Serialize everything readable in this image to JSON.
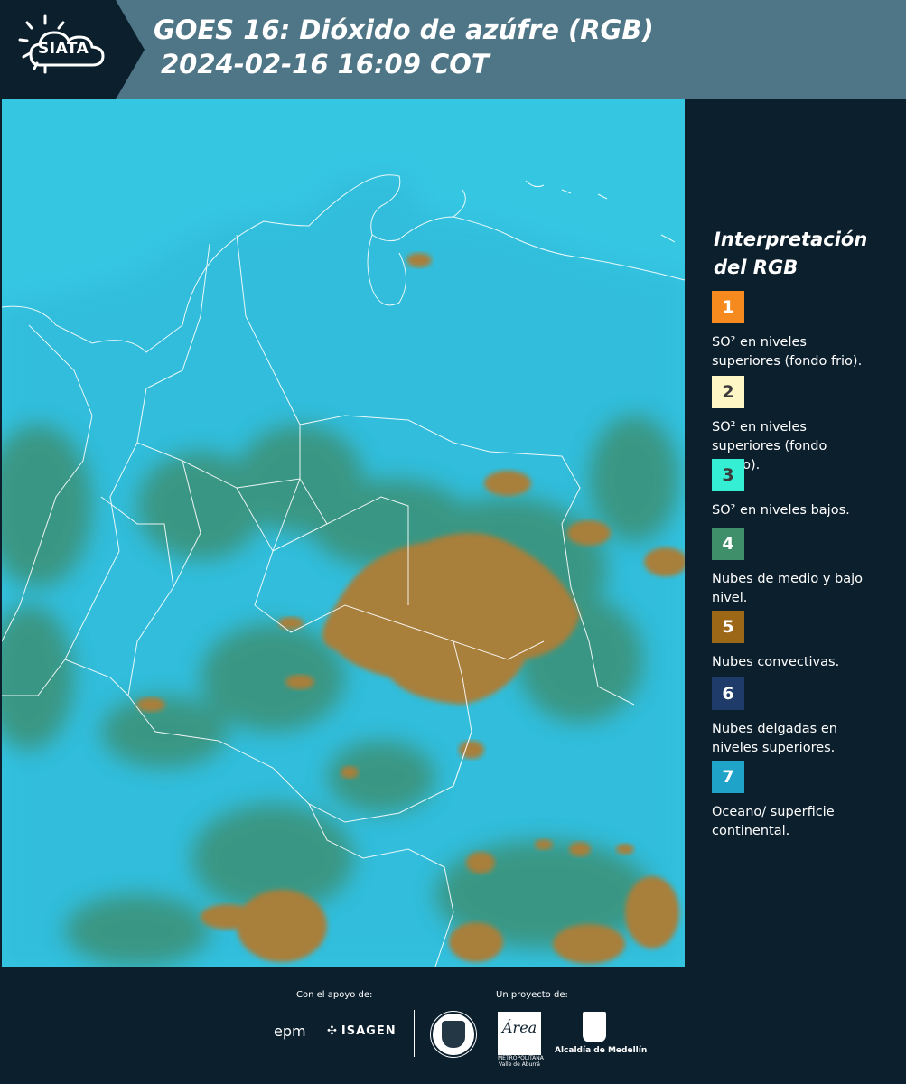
{
  "header": {
    "logo_text": "SIATA",
    "title_line1": "GOES 16: Dióxido de azúfre (RGB)",
    "title_line2": "2024-02-16 16:09 COT"
  },
  "legend": {
    "title": "Interpretación del RGB",
    "items": [
      {
        "number": "1",
        "color": "#f68a1f",
        "text_color": "#ffffff",
        "description": "SO² en niveles superiores (fondo frio)."
      },
      {
        "number": "2",
        "color": "#fff6c6",
        "text_color": "#3a3a3a",
        "description": "SO² en niveles superiores (fondo calido)."
      },
      {
        "number": "3",
        "color": "#34efd3",
        "text_color": "#3a3a3a",
        "description": "SO² en niveles bajos."
      },
      {
        "number": "4",
        "color": "#3f8f6a",
        "text_color": "#ffffff",
        "description": "Nubes de medio y bajo nivel."
      },
      {
        "number": "5",
        "color": "#9c6717",
        "text_color": "#ffffff",
        "description": "Nubes convectivas."
      },
      {
        "number": "6",
        "color": "#1e3b6a",
        "text_color": "#ffffff",
        "description": "Nubes delgadas en niveles superiores."
      },
      {
        "number": "7",
        "color": "#1fa3c9",
        "text_color": "#ffffff",
        "description": "Oceano/ superficie continental."
      }
    ]
  },
  "footer": {
    "support_label": "Con el apoyo de:",
    "project_label": "Un proyecto de:",
    "epm": "epm",
    "isagen": "ISAGEN",
    "area_word": "Área",
    "area_sub": "METROPOLITANA Valle de Aburrá",
    "alcaldia": "Alcaldía de Medellín"
  },
  "map": {
    "background_color": "#33c4e0",
    "land_tint": "#2aaecf",
    "cloud_green": "#3e8a67",
    "cloud_brown": "#a8813d",
    "border_color": "#ffffff"
  }
}
